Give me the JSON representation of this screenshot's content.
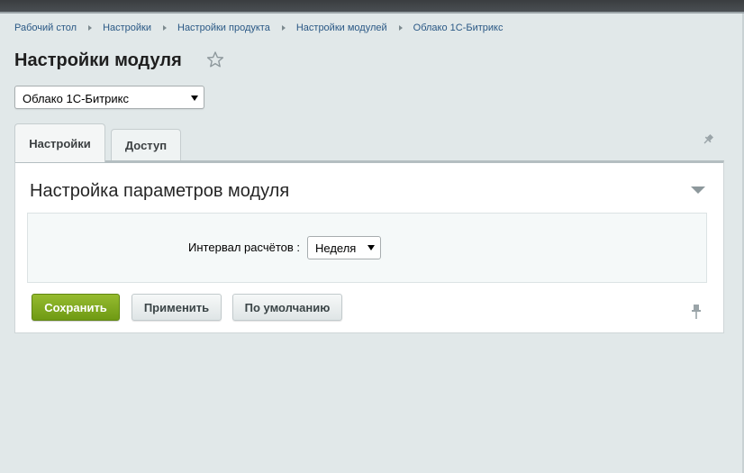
{
  "breadcrumb": [
    "Рабочий стол",
    "Настройки",
    "Настройки продукта",
    "Настройки модулей",
    "Облако 1С-Битрикс"
  ],
  "page_title": "Настройки модуля",
  "module_select": {
    "selected": "Облако 1С-Битрикс"
  },
  "tabs": [
    {
      "label": "Настройки",
      "active": true
    },
    {
      "label": "Доступ",
      "active": false
    }
  ],
  "section": {
    "title": "Настройка параметров модуля",
    "fields": [
      {
        "label": "Интервал расчётов :",
        "value": "Неделя"
      }
    ]
  },
  "buttons": {
    "save": "Сохранить",
    "apply": "Применить",
    "default": "По умолчанию"
  },
  "colors": {
    "background": "#e1e8e9",
    "link": "#2a5885",
    "save_button": "#7aa51d"
  },
  "icons": [
    "star-icon",
    "pin-icon",
    "collapse-arrow-icon",
    "chevron-down-icon"
  ]
}
